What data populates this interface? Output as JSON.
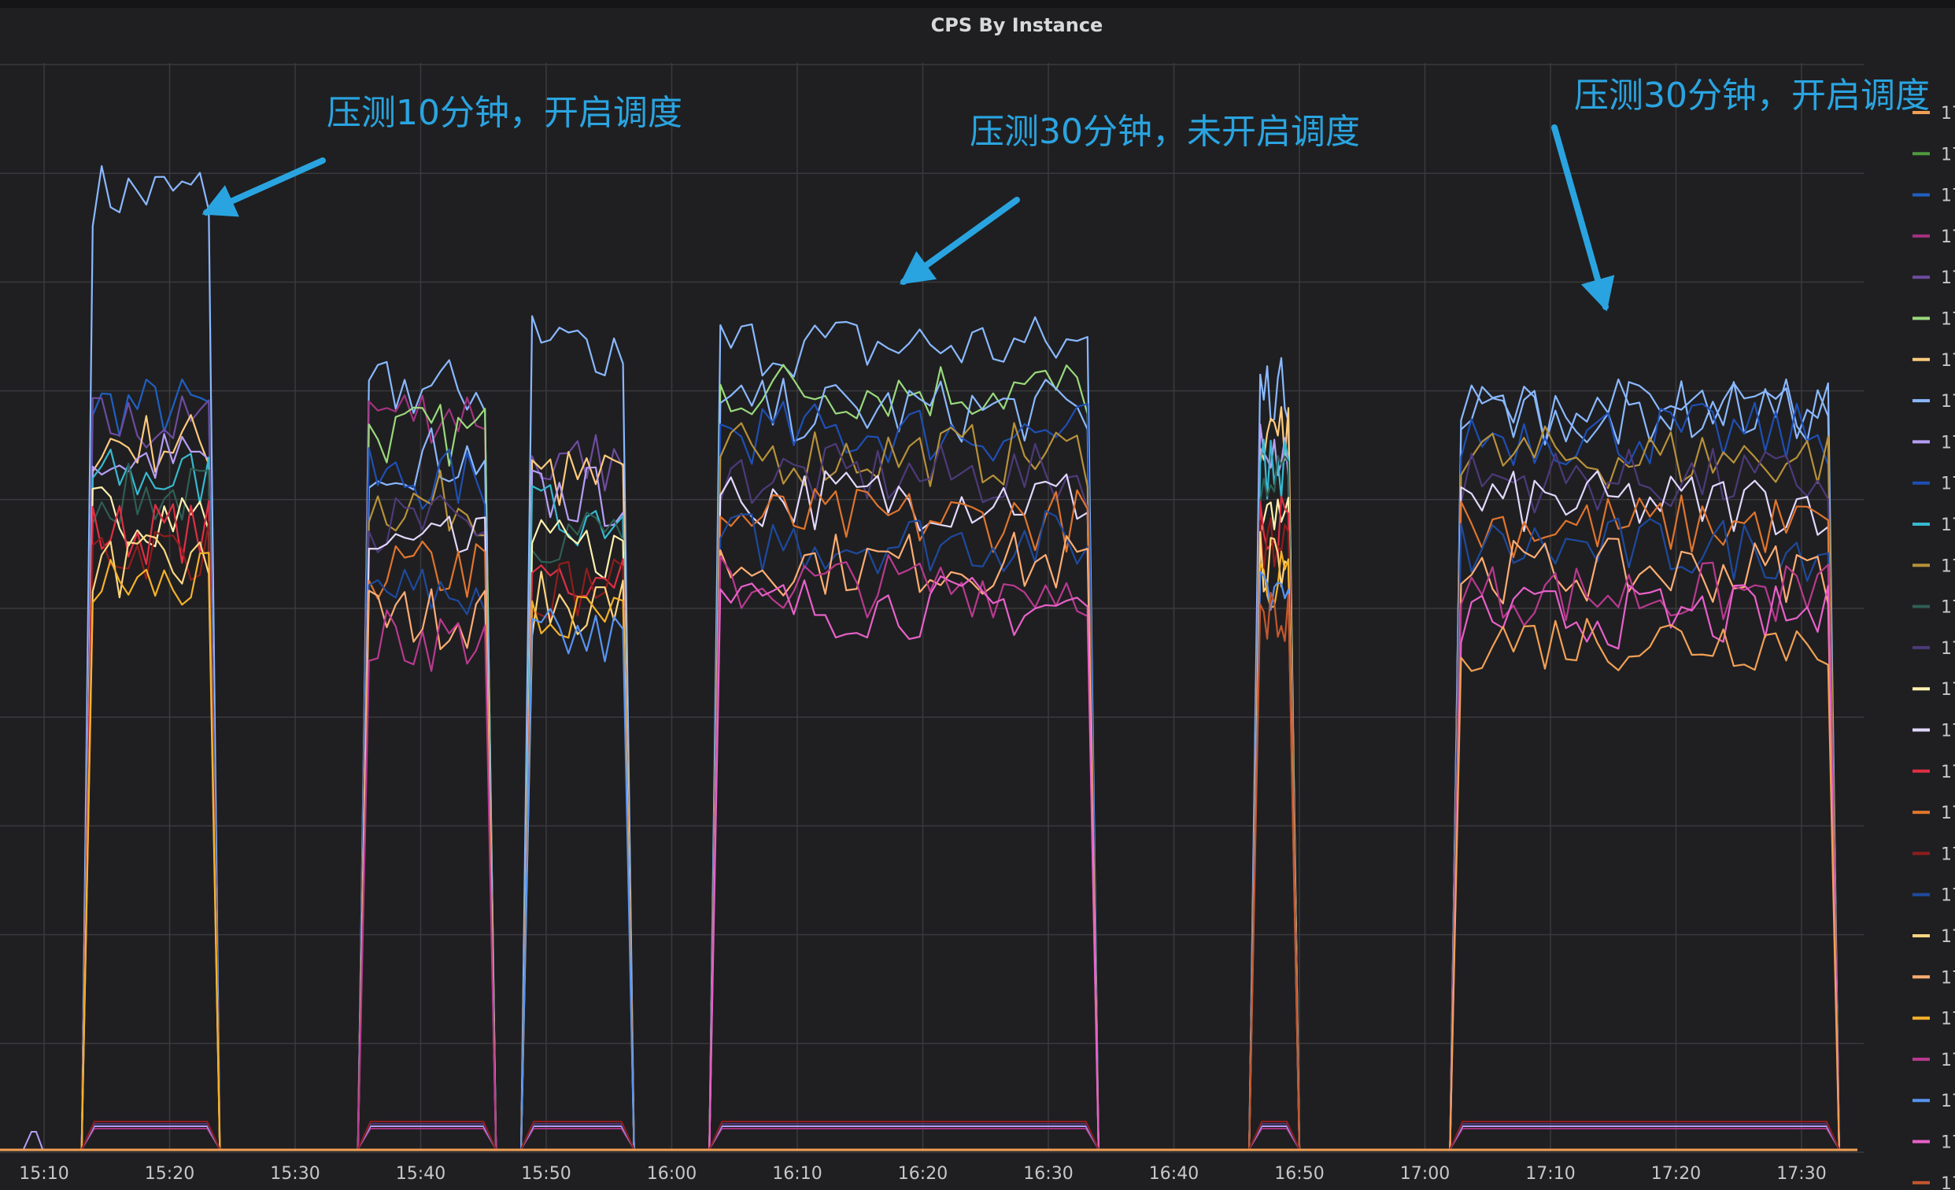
{
  "panel": {
    "title": "CPS By Instance"
  },
  "chart_data": {
    "type": "line",
    "title": "CPS By Instance",
    "xlabel": "",
    "ylabel": "",
    "x_tick_labels": [
      "15:10",
      "15:20",
      "15:30",
      "15:40",
      "15:50",
      "16:00",
      "16:10",
      "16:20",
      "16:30",
      "16:40",
      "16:50",
      "17:00",
      "17:10",
      "17:20",
      "17:30"
    ],
    "x_range_minutes": [
      9,
      35.5
    ],
    "grid": true,
    "legend": "right",
    "y_ticks_shown": false,
    "bursts": [
      {
        "start": "15:13",
        "end": "15:24"
      },
      {
        "start": "15:35",
        "end": "15:46"
      },
      {
        "start": "15:48",
        "end": "15:57"
      },
      {
        "start": "16:03",
        "end": "16:34"
      },
      {
        "start": "16:46",
        "end": "16:50"
      },
      {
        "start": "17:02",
        "end": "17:33"
      }
    ],
    "series_relative_levels": {
      "note_free": "",
      "top_series": [
        0.88,
        0.7,
        0.74,
        0.74,
        0.7,
        0.68
      ],
      "mid_series": [
        0.6,
        0.6,
        0.55,
        0.62,
        0.58,
        0.6
      ],
      "low_series": [
        0.5,
        0.45,
        0.45,
        0.48,
        0.47,
        0.45
      ]
    },
    "series": [
      {
        "name": "",
        "color": "#f2a055"
      },
      {
        "name": "",
        "color": "#4e9a3f"
      },
      {
        "name": "",
        "color": "#1f60c4"
      },
      {
        "name": "",
        "color": "#a3327f"
      },
      {
        "name": "",
        "color": "#6d4c9e"
      },
      {
        "name": "",
        "color": "#9ad97c"
      },
      {
        "name": "",
        "color": "#ffcb7d"
      },
      {
        "name": "",
        "color": "#8ab8ff"
      },
      {
        "name": "",
        "color": "#b69ef5"
      },
      {
        "name": "",
        "color": "#1f4fb5"
      },
      {
        "name": "",
        "color": "#37b9cf"
      },
      {
        "name": "",
        "color": "#b7913a"
      },
      {
        "name": "",
        "color": "#2f5e54"
      },
      {
        "name": "",
        "color": "#4d3a7a"
      },
      {
        "name": "",
        "color": "#fff1b0"
      },
      {
        "name": "",
        "color": "#e3d8ff"
      },
      {
        "name": "",
        "color": "#e02f44"
      },
      {
        "name": "",
        "color": "#e0752d"
      },
      {
        "name": "",
        "color": "#8f1d1d"
      },
      {
        "name": "",
        "color": "#1e4a9e"
      },
      {
        "name": "",
        "color": "#ffd580"
      },
      {
        "name": "",
        "color": "#ffad73"
      },
      {
        "name": "",
        "color": "#f5b12a"
      },
      {
        "name": "",
        "color": "#b83a8f"
      },
      {
        "name": "",
        "color": "#5794f2"
      },
      {
        "name": "",
        "color": "#e861c9"
      },
      {
        "name": "",
        "color": "#c4572e"
      }
    ],
    "legend_item_label": "17",
    "annotations": [
      {
        "text": "压测10分钟，开启调度"
      },
      {
        "text": "压测30分钟，未开启调度"
      },
      {
        "text": "压测30分钟，开启调度"
      }
    ]
  },
  "colors": {
    "annotation": "#2aa4e0",
    "background": "#1f1f21",
    "grid": "#3a3a3e",
    "baseline": "#f2a055"
  }
}
